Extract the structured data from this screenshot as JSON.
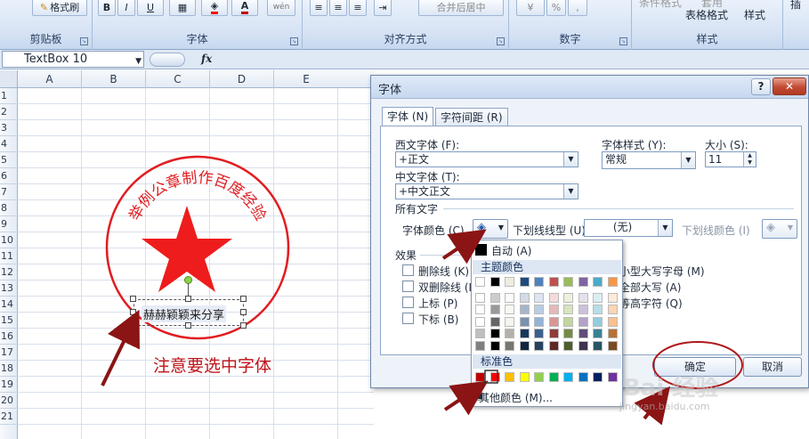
{
  "ribbon": {
    "format_painter": "格式刷",
    "bold": "B",
    "italic": "I",
    "underline": "U",
    "font_color_glyph": "A",
    "phonetic": "wén",
    "merge_center": "合并后居中",
    "percent": "%",
    "comma": ",",
    "groups": {
      "clipboard": "剪贴板",
      "font": "字体",
      "alignment": "对齐方式",
      "number": "数字",
      "styles": "样式"
    },
    "styles_row1": "条件格式",
    "styles_row1b": "套用",
    "table_format": "表格格式",
    "cell_style": "样式",
    "insert_partial": "插"
  },
  "formula_bar": {
    "name_box": "TextBox 10",
    "fx": "fx"
  },
  "sheet": {
    "columns": [
      "A",
      "B",
      "C",
      "D",
      "E"
    ],
    "rows": [
      "1",
      "2",
      "3",
      "4",
      "5",
      "6",
      "7",
      "8",
      "9",
      "10",
      "11",
      "12",
      "13",
      "14",
      "15",
      "16",
      "17",
      "18",
      "19",
      "20",
      "21"
    ]
  },
  "seal": {
    "arc_text": "举例公章制作百度经验",
    "textbox_text": "赫赫颖颖来分享"
  },
  "annotation_note": "注意要选中字体",
  "dialog": {
    "title": "字体",
    "help": "?",
    "close": "✕",
    "tabs": [
      "字体 (N)",
      "字符间距 (R)"
    ],
    "latin_font_label": "西文字体 (F):",
    "latin_font_value": "+正文",
    "asian_font_label": "中文字体 (T):",
    "asian_font_value": "+中文正文",
    "style_label": "字体样式 (Y):",
    "style_value": "常规",
    "size_label": "大小 (S):",
    "size_value": "11",
    "all_text_label": "所有文字",
    "font_color_label": "字体颜色 (C)",
    "underline_type_label": "下划线线型 (U)",
    "underline_type_value": "(无)",
    "underline_color_label": "下划线颜色 (I)",
    "effects_label": "效果",
    "effects_left": [
      "删除线 (K)",
      "双删除线 (L)",
      "上标 (P)",
      "下标 (B)"
    ],
    "effects_right": [
      "小型大写字母 (M)",
      "全部大写 (A)",
      "等高字符 (Q)"
    ],
    "ok": "确定",
    "cancel": "取消"
  },
  "palette": {
    "auto": "自动 (A)",
    "theme_colors": "主题颜色",
    "standard_colors": "标准色",
    "more_colors": "其他颜色 (M)...",
    "theme_top": [
      "#ffffff",
      "#000000",
      "#eeece1",
      "#1f497d",
      "#4f81bd",
      "#c0504d",
      "#9bbb59",
      "#8064a2",
      "#4bacc6",
      "#f79646"
    ],
    "standard": [
      "#c00000",
      "#ff0000",
      "#ffc000",
      "#ffff00",
      "#92d050",
      "#00b050",
      "#00b0f0",
      "#0070c0",
      "#002060",
      "#7030a0"
    ]
  },
  "watermark": {
    "brand": "Bai 经验",
    "url": "jingyan.baidu.com"
  }
}
